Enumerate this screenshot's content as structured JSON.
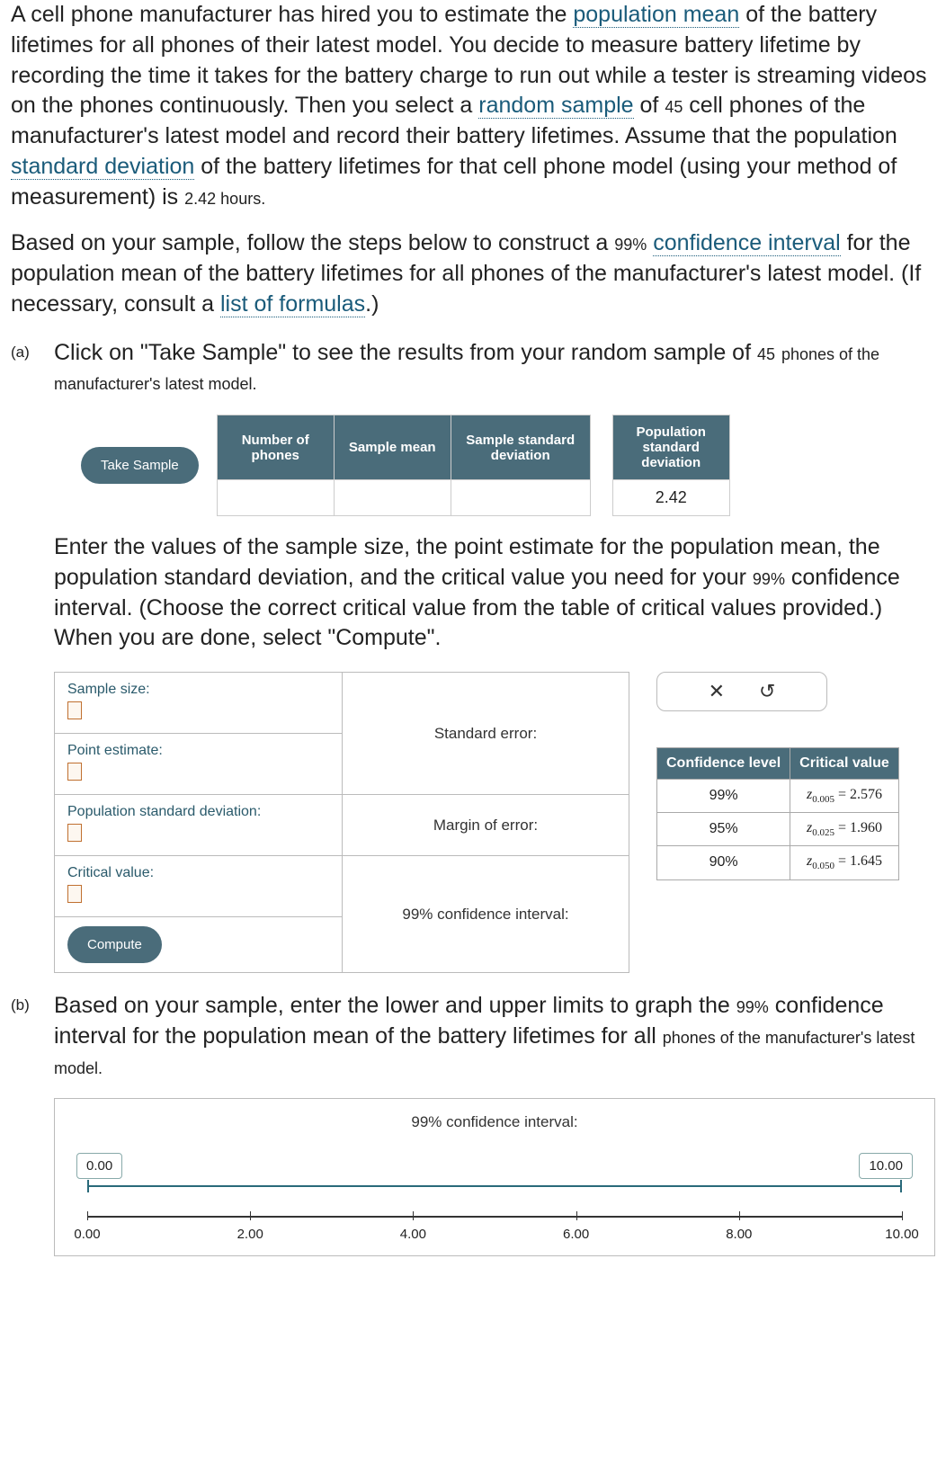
{
  "intro": {
    "seg1": "A cell phone manufacturer has hired you to estimate the ",
    "link1": "population mean",
    "seg2": " of the battery lifetimes for all phones of their latest model. You decide to measure battery lifetime by recording the time it takes for the battery charge to run out while a tester is streaming videos on the phones continuously. Then you select a ",
    "link2": "random sample",
    "seg3": " of ",
    "n1": "45",
    "seg4": " cell phones of the manufacturer's latest model and record their battery lifetimes. Assume that the population ",
    "link3": "standard deviation",
    "seg5": " of the battery lifetimes for that cell phone model (using your method of measurement) is ",
    "sigma": "2.42",
    "unit": " hours."
  },
  "intro2": {
    "seg1": "Based on your sample, follow the steps below to construct a ",
    "pct": "99%",
    "seg2": " ",
    "link1": "confidence interval",
    "seg3": " for the population mean of the battery lifetimes for all phones of the manufacturer's latest model. (If necessary, consult a ",
    "link2": "list of formulas",
    "seg4": ".)"
  },
  "partA": {
    "label": "(a)",
    "seg1": "Click on \"Take Sample\" to see the results from your random sample of ",
    "n": "45",
    "seg2": " phones of the manufacturer's latest model.",
    "take_sample": "Take Sample",
    "headers": {
      "num": "Number of phones",
      "mean": "Sample mean",
      "sdev": "Sample standard deviation",
      "psdev": "Population standard deviation"
    },
    "pop_sd_value": "2.42",
    "body2_seg1": "Enter the values of the sample size, the ",
    "body2_link1": "point estimate",
    "body2_seg2": " for the population mean, the population standard deviation, and the ",
    "body2_link2": "critical value",
    "body2_seg3": " you need for your ",
    "body2_pct": "99%",
    "body2_seg4": " confidence interval. (Choose the correct critical value from the table of critical values provided.) When you are done, select \"Compute\"."
  },
  "compute": {
    "fields": {
      "size": "Sample size:",
      "pe": "Point estimate:",
      "psd": "Population standard deviation:",
      "cv": "Critical value:"
    },
    "results": {
      "se": "Standard error:",
      "moe": "Margin of error:",
      "ci": "99% confidence interval:"
    },
    "btn": "Compute"
  },
  "ctrl": {
    "close": "✕",
    "reset": "↺"
  },
  "crit": {
    "h1": "Confidence level",
    "h2": "Critical value",
    "rows": [
      {
        "level": "99%",
        "sub": "0.005",
        "val": "2.576"
      },
      {
        "level": "95%",
        "sub": "0.025",
        "val": "1.960"
      },
      {
        "level": "90%",
        "sub": "0.050",
        "val": "1.645"
      }
    ]
  },
  "partB": {
    "label": "(b)",
    "seg1": "Based on your sample, enter the lower and upper limits to graph the ",
    "pct": "99%",
    "seg2": " confidence interval for the population mean of the battery lifetimes for all ",
    "seg3": "phones of the manufacturer's latest model."
  },
  "nl": {
    "title": "99% confidence interval:",
    "low": "0.00",
    "high": "10.00",
    "ticks": [
      "0.00",
      "2.00",
      "4.00",
      "6.00",
      "8.00",
      "10.00"
    ]
  }
}
